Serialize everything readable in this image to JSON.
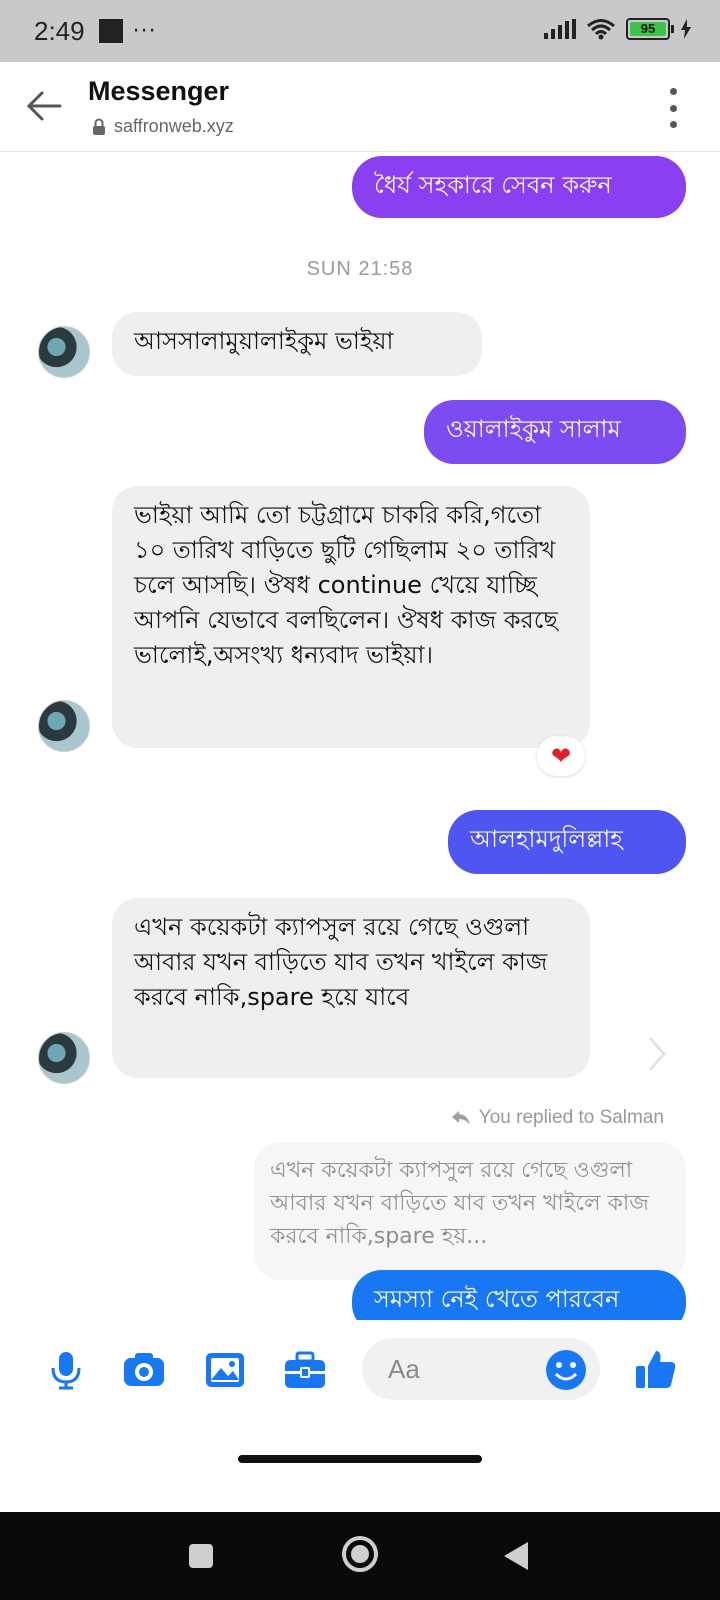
{
  "status_bar": {
    "time": "2:49",
    "dots": "···",
    "battery": "95"
  },
  "header": {
    "title": "Messenger",
    "url": "saffronweb.xyz"
  },
  "timestamp": "SUN 21:58",
  "messages": [
    {
      "text": "ধৈর্য সহকারে সেবন করুন"
    },
    {
      "text": "আসসালামুয়ালাইকুম ভাইয়া"
    },
    {
      "text": "ওয়ালাইকুম সালাম"
    },
    {
      "text": "ভাইয়া আমি তো চট্টগ্রামে চাকরি করি,গতো ১০ তারিখ বাড়িতে ছুটি গেছিলাম ২০ তারিখ চলে আসছি। ঔষধ continue খেয়ে যাচ্ছি আপনি যেভাবে বলছিলেন। ঔষধ কাজ করছে ভালোই,অসংখ্য ধন্যবাদ ভাইয়া।"
    },
    {
      "text": "আলহামদুলিল্লাহ"
    },
    {
      "text": "এখন কয়েকটা ক্যাপসুল রয়ে গেছে ওগুলা আবার যখন বাড়িতে যাব তখন খাইলে কাজ করবে নাকি,spare হয়ে যাবে"
    },
    {
      "text": "সমস্যা নেই খেতে পারবেন"
    }
  ],
  "reply_label": "You replied to Salman",
  "quoted_text": "এখন কয়েকটা ক্যাপসুল রয়ে গেছে ওগুলা আবার যখন বাড়িতে যাব তখন খাইলে কাজ করবে নাকি,spare হয়...",
  "reaction": "❤",
  "composer": {
    "placeholder": "Aa"
  },
  "colors": {
    "accent": "#1877f2",
    "bubble_violet": "#8a3ff0",
    "bubble_blue": "#3b5df2",
    "incoming": "#efeff1"
  },
  "icons": [
    "back-arrow-icon",
    "lock-icon",
    "more-vertical-icon",
    "microphone-icon",
    "camera-icon",
    "image-icon",
    "briefcase-icon",
    "emoji-icon",
    "thumbs-up-icon",
    "reply-arrow-icon",
    "heart-icon",
    "chevron-right-icon",
    "recents-icon",
    "home-icon",
    "back-icon"
  ]
}
